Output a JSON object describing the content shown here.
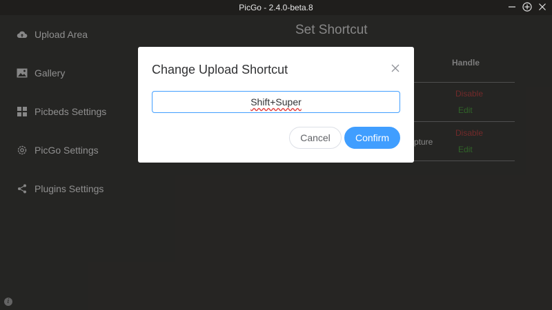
{
  "window": {
    "title": "PicGo - 2.4.0-beta.8"
  },
  "sidebar": {
    "items": [
      {
        "label": "Upload Area",
        "icon": "cloud-upload-icon"
      },
      {
        "label": "Gallery",
        "icon": "image-icon"
      },
      {
        "label": "Picbeds Settings",
        "icon": "grid-icon"
      },
      {
        "label": "PicGo Settings",
        "icon": "gear-icon"
      },
      {
        "label": "Plugins Settings",
        "icon": "share-icon"
      }
    ]
  },
  "page": {
    "title": "Set Shortcut",
    "table": {
      "handle_header": "Handle",
      "rows": [
        {
          "name": "",
          "disable": "Disable",
          "edit": "Edit"
        },
        {
          "name": "pture",
          "disable": "Disable",
          "edit": "Edit"
        }
      ]
    }
  },
  "dialog": {
    "title": "Change Upload Shortcut",
    "input_value": "Shift+Super",
    "cancel_label": "Cancel",
    "confirm_label": "Confirm"
  },
  "colors": {
    "accent": "#409eff",
    "disable_text": "#b04141",
    "edit_text": "#4a9a3e"
  }
}
